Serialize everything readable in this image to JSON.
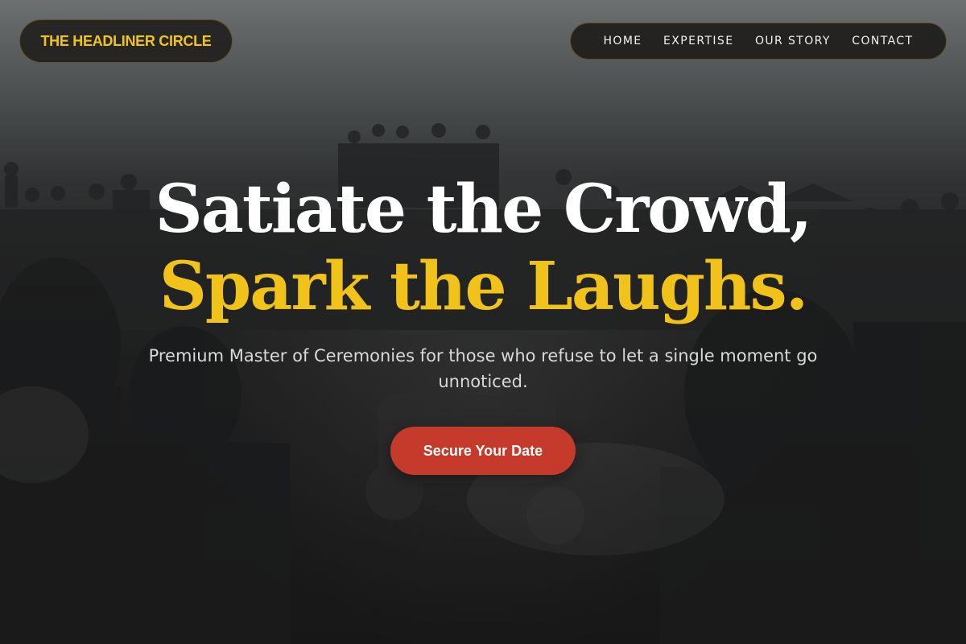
{
  "header": {
    "brand": "THE HEADLINER CIRCLE",
    "nav": [
      "HOME",
      "EXPERTISE",
      "OUR STORY",
      "CONTACT"
    ]
  },
  "hero": {
    "headline_line1": "Satiate the Crowd,",
    "headline_line2": "Spark the Laughs.",
    "subtitle": "Premium Master of Ceremonies for those who refuse to let a single moment go unnoticed.",
    "cta_label": "Secure Your Date"
  },
  "colors": {
    "accent_gold": "#f0c21a",
    "cta_red": "#c63a2b",
    "pill_bg": "#1e1d1b"
  }
}
